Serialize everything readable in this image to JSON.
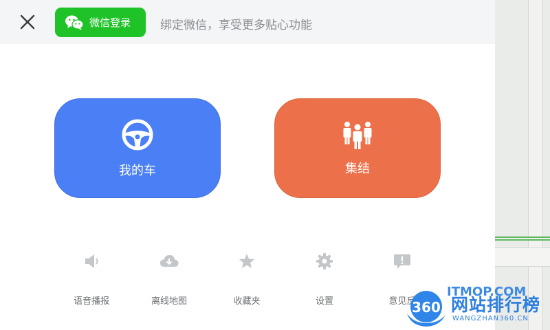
{
  "header": {
    "wechat_login_label": "微信登录",
    "hint": "绑定微信，享受更多贴心功能"
  },
  "cards": {
    "my_car_label": "我的车",
    "gather_label": "集结"
  },
  "menu": {
    "items": [
      {
        "label": "语音播报",
        "icon": "speaker-icon"
      },
      {
        "label": "离线地图",
        "icon": "cloud-download-icon"
      },
      {
        "label": "收藏夹",
        "icon": "star-icon"
      },
      {
        "label": "设置",
        "icon": "gear-icon"
      },
      {
        "label": "意见反",
        "icon": "feedback-icon"
      }
    ]
  },
  "watermark": {
    "logo_text": "360",
    "site_name": "网站排行榜",
    "overlay": "ITMOP.COM",
    "sub": "WANGZHAN360.CN"
  },
  "colors": {
    "wechat_green": "#1fc328",
    "my_car_blue": "#4a7ff5",
    "gather_orange": "#ec714a",
    "header_bg": "#f4f5f6"
  }
}
